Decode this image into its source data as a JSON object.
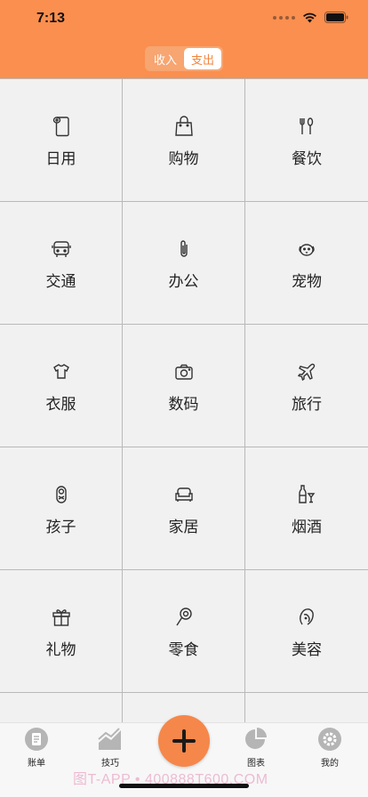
{
  "status_bar": {
    "time": "7:13"
  },
  "segment": {
    "income": "收入",
    "expense": "支出",
    "selected": "expense"
  },
  "categories": [
    {
      "label": "日用",
      "icon": "paper-roll-icon"
    },
    {
      "label": "购物",
      "icon": "shopping-bag-icon"
    },
    {
      "label": "餐饮",
      "icon": "utensils-icon"
    },
    {
      "label": "交通",
      "icon": "bus-icon"
    },
    {
      "label": "办公",
      "icon": "paperclip-icon"
    },
    {
      "label": "宠物",
      "icon": "dog-icon"
    },
    {
      "label": "衣服",
      "icon": "tshirt-icon"
    },
    {
      "label": "数码",
      "icon": "camera-icon"
    },
    {
      "label": "旅行",
      "icon": "airplane-icon"
    },
    {
      "label": "孩子",
      "icon": "baby-icon"
    },
    {
      "label": "家居",
      "icon": "sofa-icon"
    },
    {
      "label": "烟酒",
      "icon": "wine-icon"
    },
    {
      "label": "礼物",
      "icon": "gift-icon"
    },
    {
      "label": "零食",
      "icon": "lollipop-icon"
    },
    {
      "label": "美容",
      "icon": "face-icon"
    }
  ],
  "tabbar": {
    "bill": "账单",
    "tips": "技巧",
    "chart": "图表",
    "mine": "我的"
  },
  "watermark": "图T-APP • 400888T600.COM",
  "colors": {
    "accent": "#fa8f4f",
    "fab": "#f6874a",
    "grid_bg": "#f1f1f1"
  }
}
